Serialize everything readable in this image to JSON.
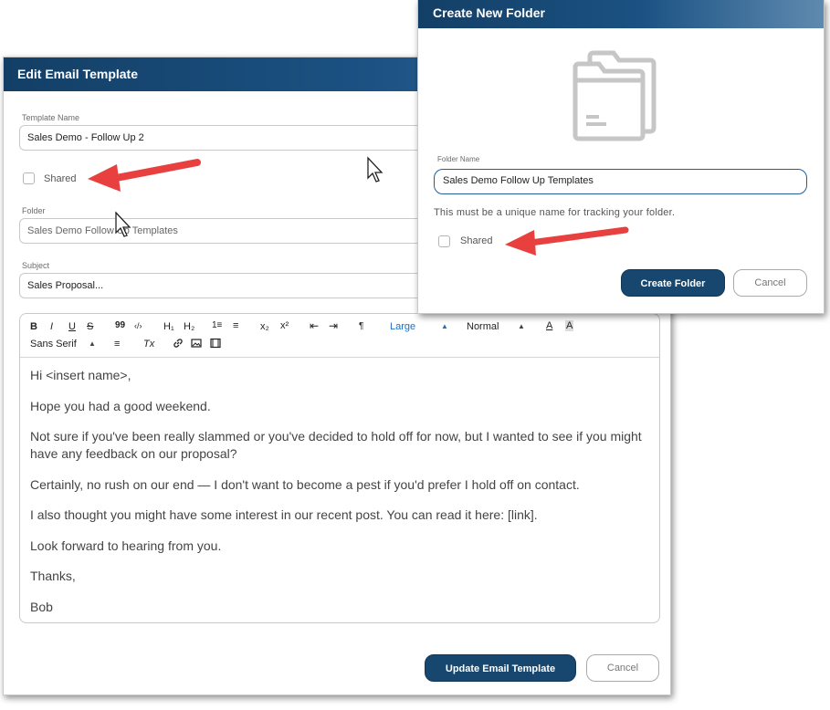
{
  "edit_dialog": {
    "title": "Edit Email Template",
    "template_name_label": "Template Name",
    "template_name_value": "Sales Demo - Follow Up 2",
    "shared_label": "Shared",
    "folder_label": "Folder",
    "folder_value": "Sales Demo Follow Up Templates",
    "subject_label": "Subject",
    "subject_value": "Sales Proposal...",
    "toolbar": {
      "bold": "B",
      "italic": "I",
      "underline": "U",
      "strike": "S",
      "quote": "99",
      "code": "‹/›",
      "h1": "H₁",
      "h2": "H₂",
      "ordered_list": "1≡",
      "bullet_list": "≡",
      "subscript": "x₂",
      "superscript": "x²",
      "outdent": "⇤",
      "indent": "⇥",
      "rtl": "¶",
      "size": "Large",
      "header": "Normal",
      "font": "Sans Serif",
      "align": "≡",
      "clear": "Tx"
    },
    "body_paragraphs": [
      "Hi <insert name>,",
      "Hope you had a good weekend.",
      "Not sure if you've been really slammed or you've decided to hold off for now, but I wanted to see if you might have any feedback on our proposal?",
      "Certainly, no rush on our end — I don't want to become a pest if you'd prefer I hold off on contact.",
      "I also thought you might have some interest in our recent post. You can read it here: [link].",
      "Look forward to hearing from you.",
      "Thanks,",
      "Bob"
    ],
    "update_button": "Update Email Template",
    "cancel_button": "Cancel"
  },
  "folder_dialog": {
    "title": "Create New Folder",
    "folder_name_label": "Folder Name",
    "folder_name_value": "Sales Demo Follow Up Templates",
    "helper_text": "This must be a unique name for tracking your folder.",
    "shared_label": "Shared",
    "create_button": "Create Folder",
    "cancel_button": "Cancel"
  },
  "colors": {
    "header_dark": "#133f66",
    "primary_button": "#17476f",
    "annotation_arrow": "#e8403f",
    "focus_border": "#1f5f9a"
  }
}
